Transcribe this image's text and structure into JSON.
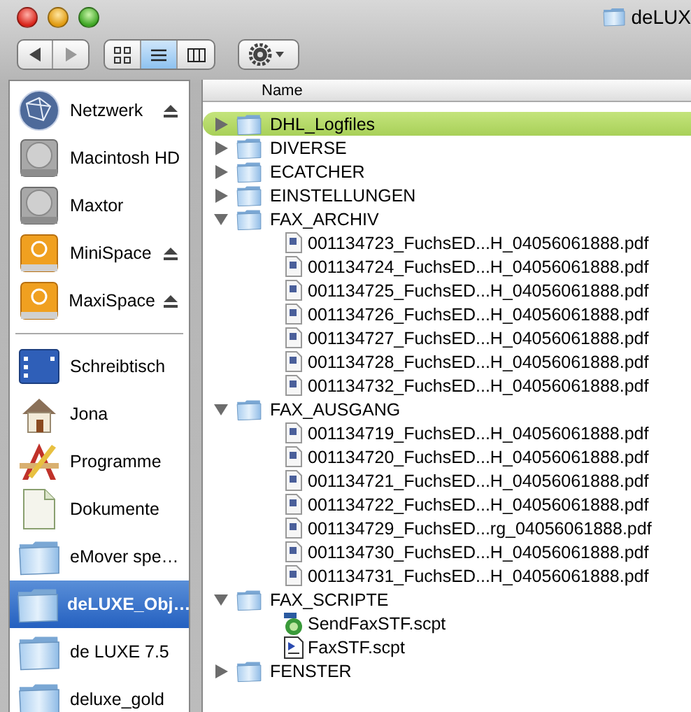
{
  "window": {
    "title": "deLUX"
  },
  "toolbar": {
    "views": [
      {
        "kind": "icon",
        "selected": false
      },
      {
        "kind": "list",
        "selected": true
      },
      {
        "kind": "column",
        "selected": false
      }
    ]
  },
  "sidebar": {
    "devices": [
      {
        "name": "Netzwerk",
        "kind": "network",
        "ejectable": true,
        "selected": false
      },
      {
        "name": "Macintosh HD",
        "kind": "disk",
        "ejectable": false,
        "selected": false
      },
      {
        "name": "Maxtor",
        "kind": "disk",
        "ejectable": false,
        "selected": false
      },
      {
        "name": "MiniSpace",
        "kind": "firewire",
        "ejectable": true,
        "selected": false
      },
      {
        "name": "MaxiSpace",
        "kind": "firewire",
        "ejectable": true,
        "selected": false
      }
    ],
    "places": [
      {
        "name": "Schreibtisch",
        "kind": "desktop",
        "selected": false
      },
      {
        "name": "Jona",
        "kind": "home",
        "selected": false
      },
      {
        "name": "Programme",
        "kind": "apps",
        "selected": false
      },
      {
        "name": "Dokumente",
        "kind": "document",
        "selected": false
      },
      {
        "name": "eMover spe…",
        "kind": "folder",
        "selected": false
      },
      {
        "name": "deLUXE_Obj…",
        "kind": "folder",
        "selected": true
      },
      {
        "name": "de LUXE 7.5",
        "kind": "folder",
        "selected": false
      },
      {
        "name": "deluxe_gold",
        "kind": "folder",
        "selected": false
      }
    ]
  },
  "list": {
    "column": "Name",
    "items": [
      {
        "name": "DHL_Logfiles",
        "kind": "folder",
        "expanded": false,
        "selected": true
      },
      {
        "name": "DIVERSE",
        "kind": "folder",
        "expanded": false,
        "selected": false
      },
      {
        "name": "ECATCHER",
        "kind": "folder",
        "expanded": false,
        "selected": false
      },
      {
        "name": "EINSTELLUNGEN",
        "kind": "folder",
        "expanded": false,
        "selected": false
      },
      {
        "name": "FAX_ARCHIV",
        "kind": "folder",
        "expanded": true,
        "selected": false,
        "children": [
          {
            "name": "001134723_FuchsED...H_04056061888.pdf",
            "kind": "pdf",
            "selected": false
          },
          {
            "name": "001134724_FuchsED...H_04056061888.pdf",
            "kind": "pdf",
            "selected": false
          },
          {
            "name": "001134725_FuchsED...H_04056061888.pdf",
            "kind": "pdf",
            "selected": false
          },
          {
            "name": "001134726_FuchsED...H_04056061888.pdf",
            "kind": "pdf",
            "selected": false
          },
          {
            "name": "001134727_FuchsED...H_04056061888.pdf",
            "kind": "pdf",
            "selected": false
          },
          {
            "name": "001134728_FuchsED...H_04056061888.pdf",
            "kind": "pdf",
            "selected": false
          },
          {
            "name": "001134732_FuchsED...H_04056061888.pdf",
            "kind": "pdf",
            "selected": false
          }
        ]
      },
      {
        "name": "FAX_AUSGANG",
        "kind": "folder",
        "expanded": true,
        "selected": false,
        "children": [
          {
            "name": "001134719_FuchsED...H_04056061888.pdf",
            "kind": "pdf",
            "selected": false
          },
          {
            "name": "001134720_FuchsED...H_04056061888.pdf",
            "kind": "pdf",
            "selected": false
          },
          {
            "name": "001134721_FuchsED...H_04056061888.pdf",
            "kind": "pdf",
            "selected": false
          },
          {
            "name": "001134722_FuchsED...H_04056061888.pdf",
            "kind": "pdf",
            "selected": false
          },
          {
            "name": "001134729_FuchsED...rg_04056061888.pdf",
            "kind": "pdf",
            "selected": false
          },
          {
            "name": "001134730_FuchsED...H_04056061888.pdf",
            "kind": "pdf",
            "selected": false
          },
          {
            "name": "001134731_FuchsED...H_04056061888.pdf",
            "kind": "pdf",
            "selected": false
          }
        ]
      },
      {
        "name": "FAX_SCRIPTE",
        "kind": "folder",
        "expanded": true,
        "selected": false,
        "children": [
          {
            "name": "SendFaxSTF.scpt",
            "kind": "applet",
            "selected": false
          },
          {
            "name": "FaxSTF.scpt",
            "kind": "script",
            "selected": false
          }
        ]
      },
      {
        "name": "FENSTER",
        "kind": "folder",
        "expanded": false,
        "selected": false
      }
    ]
  }
}
